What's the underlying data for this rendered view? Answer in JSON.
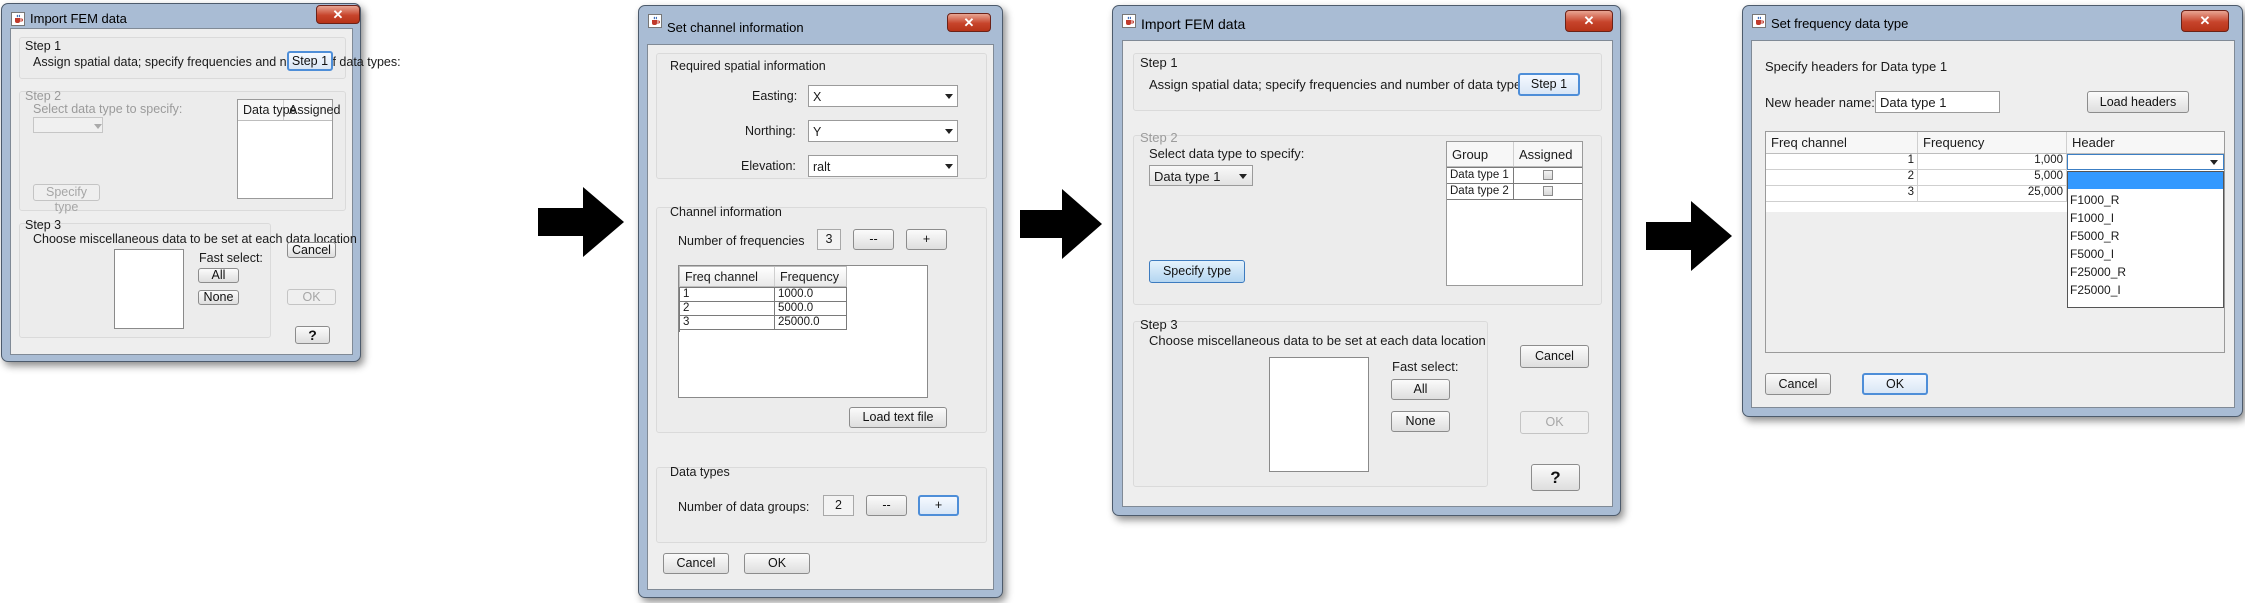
{
  "d1": {
    "title": "Import FEM data",
    "step1_title": "Step 1",
    "step1_text": "Assign spatial data; specify frequencies and number of data types:",
    "step1_button": "Step 1",
    "step2_title": "Step 2",
    "step2_text": "Select data type to specify:",
    "col_datatype": "Data type",
    "col_assigned": "Assigned",
    "specify_button": "Specify type",
    "step3_title": "Step 3",
    "step3_text": "Choose miscellaneous data to be set at each data location",
    "fast_select": "Fast select:",
    "all_button": "All",
    "none_button": "None",
    "cancel_button": "Cancel",
    "ok_button": "OK",
    "help_button": "?"
  },
  "d2": {
    "title": "Set channel information",
    "spatial_group": "Required spatial information",
    "easting_label": "Easting:",
    "easting_value": "X",
    "northing_label": "Northing:",
    "northing_value": "Y",
    "elevation_label": "Elevation:",
    "elevation_value": "ralt",
    "channel_group": "Channel information",
    "num_freq_label": "Number of frequencies",
    "num_freq_value": "3",
    "minus_label": "--",
    "plus_label": "+",
    "col_freq_channel": "Freq channel",
    "col_frequency": "Frequency",
    "rows": [
      {
        "ch": "1",
        "freq": "1000.0"
      },
      {
        "ch": "2",
        "freq": "5000.0"
      },
      {
        "ch": "3",
        "freq": "25000.0"
      }
    ],
    "load_text_button": "Load text file",
    "datatypes_group": "Data types",
    "num_groups_label": "Number of data groups:",
    "num_groups_value": "2",
    "cancel_button": "Cancel",
    "ok_button": "OK"
  },
  "d3": {
    "title": "Import FEM data",
    "step1_title": "Step 1",
    "step1_text": "Assign spatial data; specify frequencies and number of data types:",
    "step1_button": "Step 1",
    "step2_title": "Step 2",
    "step2_text": "Select data type to specify:",
    "combo_value": "Data type 1",
    "col_group": "Group",
    "col_assigned": "Assigned",
    "groups": [
      "Data type 1",
      "Data type 2"
    ],
    "specify_button": "Specify type",
    "step3_title": "Step 3",
    "step3_text": "Choose miscellaneous data to be set at each data location",
    "fast_select": "Fast select:",
    "all_button": "All",
    "none_button": "None",
    "cancel_button": "Cancel",
    "ok_button": "OK",
    "help_button": "?"
  },
  "d4": {
    "title": "Set frequency data type",
    "heading": "Specify headers for Data type 1",
    "new_header_label": "New header name:",
    "new_header_value": "Data type 1",
    "load_headers_button": "Load headers",
    "col_freq_channel": "Freq channel",
    "col_frequency": "Frequency",
    "col_header": "Header",
    "rows": [
      {
        "ch": "1",
        "freq": "1,000"
      },
      {
        "ch": "2",
        "freq": "5,000"
      },
      {
        "ch": "3",
        "freq": "25,000"
      }
    ],
    "options": [
      "F1000_R",
      "F1000_I",
      "F5000_R",
      "F5000_I",
      "F25000_R",
      "F25000_I"
    ],
    "cancel_button": "Cancel",
    "ok_button": "OK"
  },
  "icons": {
    "title_icon": "java-cup-icon",
    "close": "close-icon",
    "step_arrow": "arrow-right-icon"
  },
  "colors": {
    "close_button": "#c7442b",
    "focus_border": "#4e8ed8",
    "selection": "#3399ff"
  }
}
